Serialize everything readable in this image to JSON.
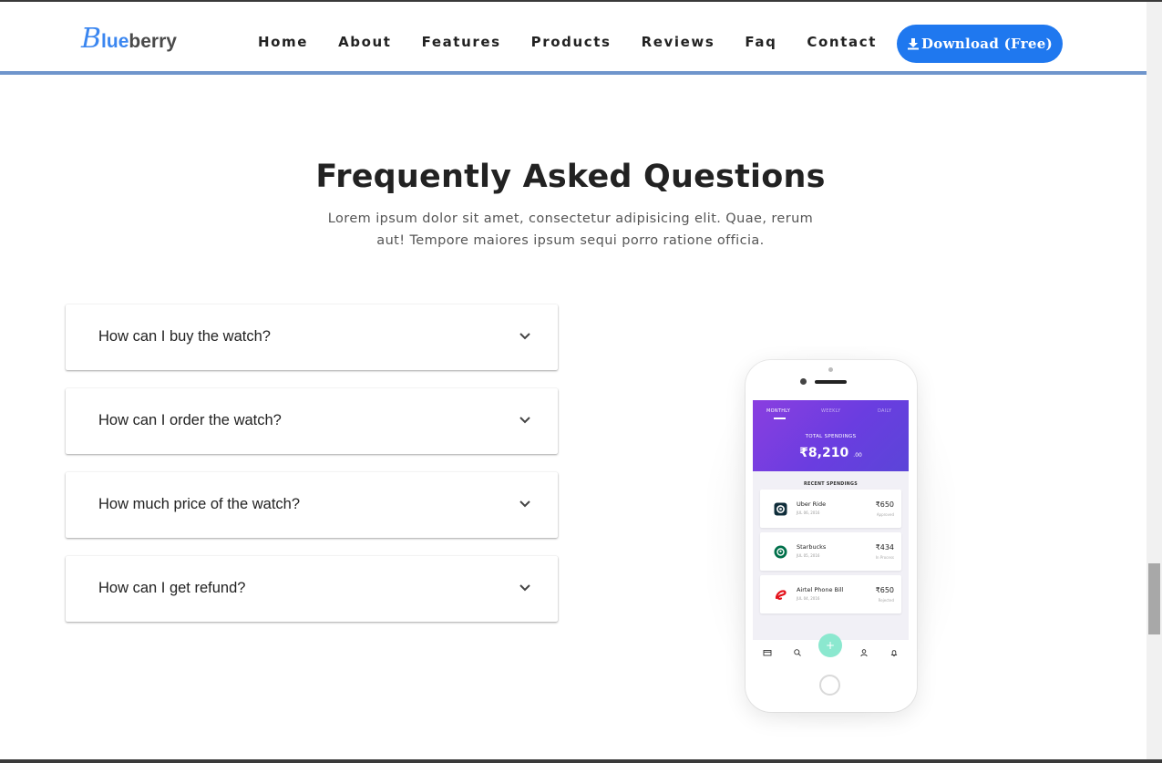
{
  "nav": {
    "logo_b": "B",
    "logo_lue": "lue",
    "logo_berry": "berry",
    "links": [
      "Home",
      "About",
      "Features",
      "Products",
      "Reviews",
      "Faq",
      "Contact"
    ],
    "download_label": "Download (Free)"
  },
  "faq": {
    "title": "Frequently Asked Questions",
    "subtitle": "Lorem ipsum dolor sit amet, consectetur adipisicing elit. Quae, rerum aut! Tempore maiores ipsum sequi porro ratione officia.",
    "questions": [
      "How can I buy the watch?",
      "How can I order the watch?",
      "How much price of the watch?",
      "How can I get refund?"
    ]
  },
  "phone": {
    "tabs": [
      "MONTHLY",
      "WEEKLY",
      "DAILY"
    ],
    "total_label": "TOTAL SPENDINGS",
    "total_amount": "₹8,210",
    "total_decimal": ".00",
    "recent_label": "RECENT SPENDINGS",
    "transactions": [
      {
        "name": "Uber Ride",
        "date": "JUL 06, 2016",
        "amount": "₹650",
        "status": "Approved",
        "icon": "uber-icon"
      },
      {
        "name": "Starbucks",
        "date": "JUL 05, 2016",
        "amount": "₹434",
        "status": "In Process",
        "icon": "starbucks-icon"
      },
      {
        "name": "Airtel Phone Bill",
        "date": "JUL 04, 2016",
        "amount": "₹650",
        "status": "Rejected",
        "icon": "airtel-icon"
      }
    ],
    "fab_label": "+"
  },
  "colors": {
    "brand_blue": "#1f78ef",
    "nav_divider": "#6f95cc",
    "purple_header": "#7a3ee0",
    "fab_mint": "#8be8cf"
  }
}
